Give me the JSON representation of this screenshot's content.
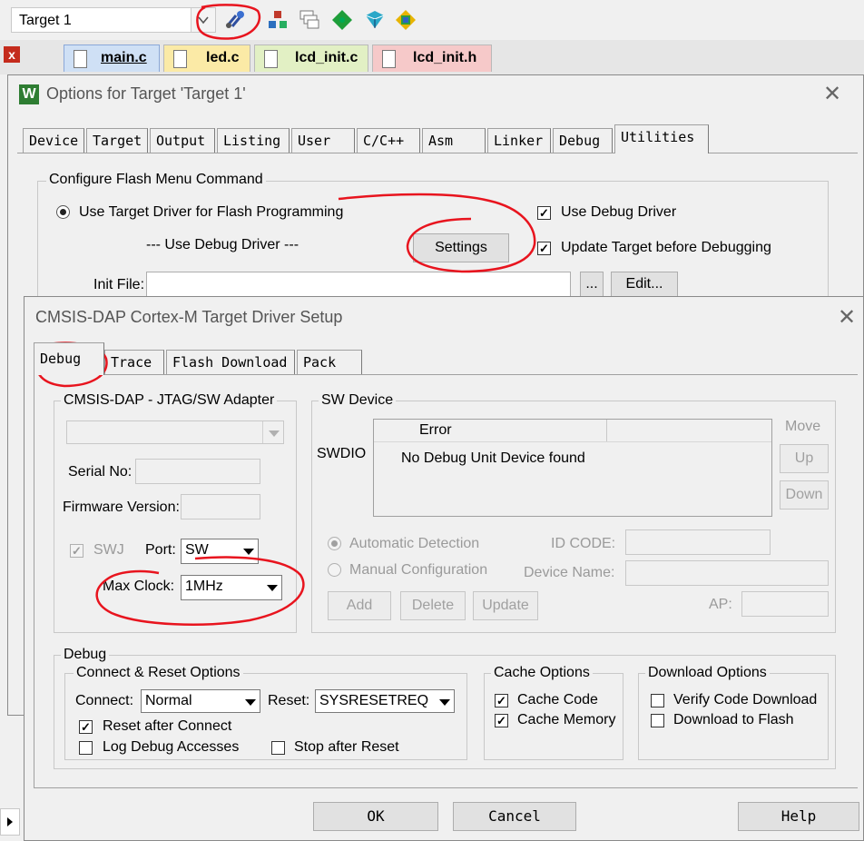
{
  "ide": {
    "target_name": "Target 1",
    "editor_tabs": [
      {
        "label": "main.c",
        "color": "#cfe0f5"
      },
      {
        "label": "led.c",
        "color": "#fbeaa6"
      },
      {
        "label": "lcd_init.c",
        "color": "#e2f0c4"
      },
      {
        "label": "lcd_init.h",
        "color": "#f6c9c9"
      }
    ],
    "close_glyph": "x"
  },
  "options_dialog": {
    "title": "Options for Target 'Target 1'",
    "tabs": [
      "Device",
      "Target",
      "Output",
      "Listing",
      "User",
      "C/C++",
      "Asm",
      "Linker",
      "Debug",
      "Utilities"
    ],
    "active_tab": "Utilities",
    "group_title": "Configure Flash Menu Command",
    "use_target_driver": "Use Target Driver for Flash Programming",
    "use_debug_driver_dashed": "--- Use Debug Driver ---",
    "settings_button": "Settings",
    "use_debug_driver_check": "Use Debug Driver",
    "update_target": "Update Target before Debugging",
    "init_file_label": "Init File:",
    "browse_button": "...",
    "edit_button": "Edit..."
  },
  "cmsis_dialog": {
    "title": "CMSIS-DAP Cortex-M Target Driver Setup",
    "tabs": [
      "Debug",
      "Trace",
      "Flash Download",
      "Pack"
    ],
    "active_tab": "Debug",
    "adapter": {
      "group_title": "CMSIS-DAP - JTAG/SW Adapter",
      "serial_label": "Serial No:",
      "firmware_label": "Firmware Version:",
      "swj_label": "SWJ",
      "port_label": "Port:",
      "port_value": "SW",
      "maxclock_label": "Max Clock:",
      "maxclock_value": "1MHz"
    },
    "sw_device": {
      "group_title": "SW Device",
      "swdio_label": "SWDIO",
      "col_error": "Error",
      "error_message": "No Debug Unit Device found",
      "move_label": "Move",
      "up_button": "Up",
      "down_button": "Down",
      "auto_detect": "Automatic Detection",
      "manual_config": "Manual Configuration",
      "id_code_label": "ID CODE:",
      "device_name_label": "Device Name:",
      "add_button": "Add",
      "delete_button": "Delete",
      "update_button": "Update",
      "ap_label": "AP:"
    },
    "debug": {
      "group_title": "Debug",
      "connect_reset_title": "Connect & Reset Options",
      "connect_label": "Connect:",
      "connect_value": "Normal",
      "reset_label": "Reset:",
      "reset_value": "SYSRESETREQ",
      "reset_after_connect": "Reset after Connect",
      "log_debug": "Log Debug Accesses",
      "stop_after_reset": "Stop after Reset",
      "cache_title": "Cache Options",
      "cache_code": "Cache Code",
      "cache_memory": "Cache Memory",
      "download_title": "Download Options",
      "verify_code": "Verify Code Download",
      "download_flash": "Download to Flash"
    },
    "buttons": {
      "ok": "OK",
      "cancel": "Cancel",
      "help": "Help"
    }
  },
  "colors": {
    "annotation_red": "#e8141e",
    "keil_green": "#2e7d32"
  }
}
